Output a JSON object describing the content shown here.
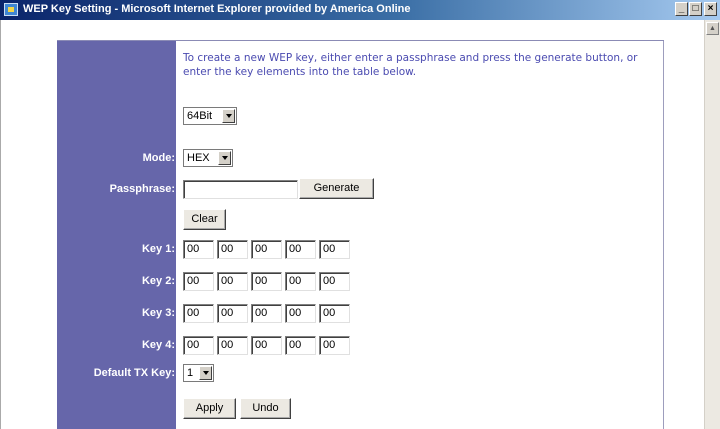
{
  "window": {
    "title": "WEP Key Setting - Microsoft Internet Explorer provided by America Online",
    "minimize_glyph": "_",
    "maximize_glyph": "□",
    "close_glyph": "×"
  },
  "scrollbar": {
    "up_glyph": "▲"
  },
  "intro_text": "To create a new WEP key, either enter a passphrase and press the generate button, or enter the key elements into the table below.",
  "key_size": {
    "selected": "64Bit"
  },
  "mode": {
    "label": "Mode:",
    "selected": "HEX"
  },
  "passphrase": {
    "label": "Passphrase:",
    "value": "",
    "generate_label": "Generate"
  },
  "clear_label": "Clear",
  "keys": [
    {
      "label": "Key 1:",
      "values": [
        "00",
        "00",
        "00",
        "00",
        "00"
      ]
    },
    {
      "label": "Key 2:",
      "values": [
        "00",
        "00",
        "00",
        "00",
        "00"
      ]
    },
    {
      "label": "Key 3:",
      "values": [
        "00",
        "00",
        "00",
        "00",
        "00"
      ]
    },
    {
      "label": "Key 4:",
      "values": [
        "00",
        "00",
        "00",
        "00",
        "00"
      ]
    }
  ],
  "default_tx_key": {
    "label": "Default TX Key:",
    "selected": "1"
  },
  "apply_label": "Apply",
  "undo_label": "Undo"
}
